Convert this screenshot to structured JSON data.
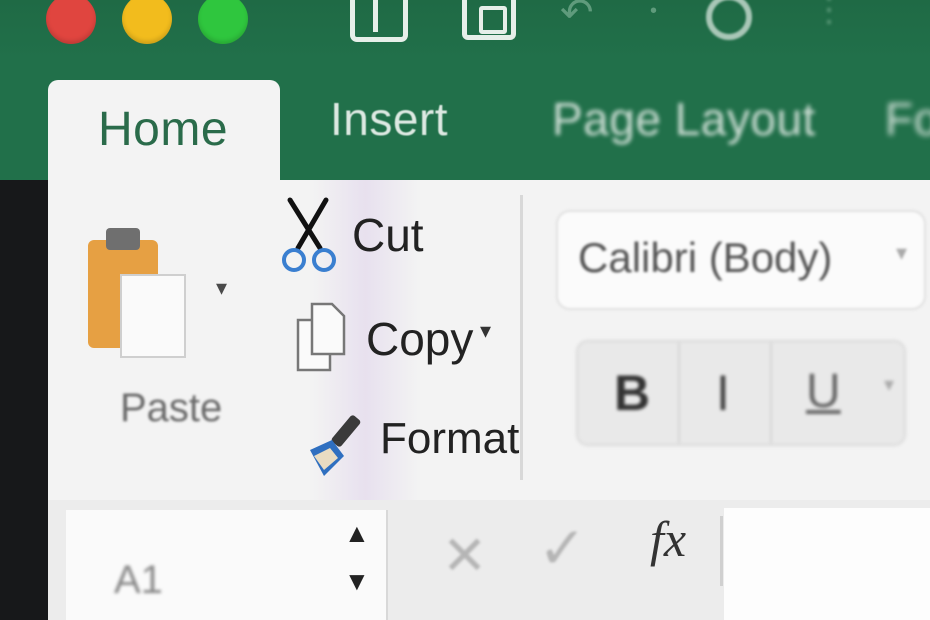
{
  "window": {
    "controls": [
      "close",
      "minimize",
      "maximize"
    ],
    "colors": {
      "close": "#e0453f",
      "minimize": "#f2bc1d",
      "maximize": "#2fc63e",
      "titlebar": "#21704a"
    }
  },
  "quick_access": [
    "sidebar-icon",
    "save-icon",
    "undo-icon",
    "redo-icon",
    "more-icon"
  ],
  "tabs": [
    {
      "label": "Home",
      "active": true
    },
    {
      "label": "Insert"
    },
    {
      "label": "Page Layout"
    },
    {
      "label": "Fo"
    }
  ],
  "clipboard": {
    "paste_label": "Paste",
    "dropdown_arrow": "▾",
    "cut_label": "Cut",
    "copy_label": "Copy",
    "format_label": "Format"
  },
  "font": {
    "name": "Calibri (Body)",
    "dropdown_arrow": "▾",
    "bold": "B",
    "italic": "I",
    "underline": "U"
  },
  "formula_bar": {
    "name_box_value": "A1",
    "up_arrow": "▲",
    "down_arrow": "▼",
    "cancel": "✕",
    "enter": "✓",
    "fx": "fx"
  }
}
